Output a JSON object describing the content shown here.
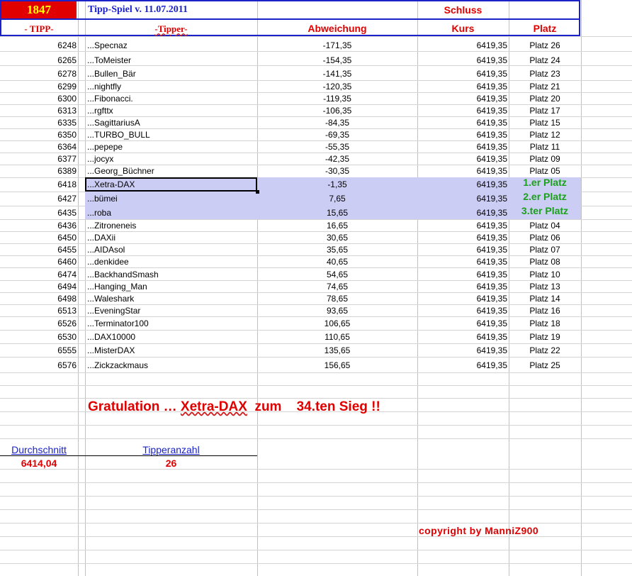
{
  "header": {
    "badge": "1847",
    "title": "Tipp-Spiel v. 11.07.2011",
    "schluss": "Schluss",
    "col_tipp": "- TIPP-",
    "col_tipper": "-Tipper-",
    "col_abweichung": "Abweichung",
    "col_kurs": "Kurs",
    "col_platz": "Platz"
  },
  "rows": [
    {
      "tipp": "6248",
      "name": "...Specnaz",
      "abw": "-171,35",
      "kurs": "6419,35",
      "platz": "Platz 26"
    },
    {
      "tipp": "6265",
      "name": "...ToMeister",
      "abw": "-154,35",
      "kurs": "6419,35",
      "platz": "Platz 24"
    },
    {
      "tipp": "6278",
      "name": "...Bullen_Bär",
      "abw": "-141,35",
      "kurs": "6419,35",
      "platz": "Platz 23"
    },
    {
      "tipp": "6299",
      "name": "...nightfly",
      "abw": "-120,35",
      "kurs": "6419,35",
      "platz": "Platz 21"
    },
    {
      "tipp": "6300",
      "name": "...Fibonacci.",
      "abw": "-119,35",
      "kurs": "6419,35",
      "platz": "Platz 20"
    },
    {
      "tipp": "6313",
      "name": "...rgfttx",
      "abw": "-106,35",
      "kurs": "6419,35",
      "platz": "Platz 17"
    },
    {
      "tipp": "6335",
      "name": "...SagittariusA",
      "abw": "-84,35",
      "kurs": "6419,35",
      "platz": "Platz 15"
    },
    {
      "tipp": "6350",
      "name": "...TURBO_BULL",
      "abw": "-69,35",
      "kurs": "6419,35",
      "platz": "Platz 12"
    },
    {
      "tipp": "6364",
      "name": "...pepepe",
      "abw": "-55,35",
      "kurs": "6419,35",
      "platz": "Platz 11"
    },
    {
      "tipp": "6377",
      "name": "...jocyx",
      "abw": "-42,35",
      "kurs": "6419,35",
      "platz": "Platz 09"
    },
    {
      "tipp": "6389",
      "name": "...Georg_Büchner",
      "abw": "-30,35",
      "kurs": "6419,35",
      "platz": "Platz 05"
    },
    {
      "tipp": "6418",
      "name": "...Xetra-DAX",
      "abw": "-1,35",
      "kurs": "6419,35",
      "platz": "1.er Platz"
    },
    {
      "tipp": "6427",
      "name": "...bümei",
      "abw": "7,65",
      "kurs": "6419,35",
      "platz": "2.er Platz"
    },
    {
      "tipp": "6435",
      "name": "...roba",
      "abw": "15,65",
      "kurs": "6419,35",
      "platz": "3.ter Platz"
    },
    {
      "tipp": "6436",
      "name": "...Zitroneneis",
      "abw": "16,65",
      "kurs": "6419,35",
      "platz": "Platz 04"
    },
    {
      "tipp": "6450",
      "name": "...DAXii",
      "abw": "30,65",
      "kurs": "6419,35",
      "platz": "Platz 06"
    },
    {
      "tipp": "6455",
      "name": "...AIDAsol",
      "abw": "35,65",
      "kurs": "6419,35",
      "platz": "Platz 07"
    },
    {
      "tipp": "6460",
      "name": "...denkidee",
      "abw": "40,65",
      "kurs": "6419,35",
      "platz": "Platz 08"
    },
    {
      "tipp": "6474",
      "name": "...BackhandSmash",
      "abw": "54,65",
      "kurs": "6419,35",
      "platz": "Platz 10"
    },
    {
      "tipp": "6494",
      "name": "...Hanging_Man",
      "abw": "74,65",
      "kurs": "6419,35",
      "platz": "Platz 13"
    },
    {
      "tipp": "6498",
      "name": "...Waleshark",
      "abw": "78,65",
      "kurs": "6419,35",
      "platz": "Platz 14"
    },
    {
      "tipp": "6513",
      "name": "...EveningStar",
      "abw": "93,65",
      "kurs": "6419,35",
      "platz": "Platz 16"
    },
    {
      "tipp": "6526",
      "name": "...Terminator100",
      "abw": "106,65",
      "kurs": "6419,35",
      "platz": "Platz 18"
    },
    {
      "tipp": "6530",
      "name": "...DAX10000",
      "abw": "110,65",
      "kurs": "6419,35",
      "platz": "Platz 19"
    },
    {
      "tipp": "6555",
      "name": "...MisterDAX",
      "abw": "135,65",
      "kurs": "6419,35",
      "platz": "Platz 22"
    },
    {
      "tipp": "6576",
      "name": "...Zickzackmaus",
      "abw": "156,65",
      "kurs": "6419,35",
      "platz": "Platz 25"
    }
  ],
  "congrats": {
    "prefix": "Gratulation  …",
    "winner": "Xetra-DAX",
    "suffix": "  zum    34.ten Sieg !!"
  },
  "summary": {
    "avg_label": "Durchschnitt",
    "avg_value": "6414,04",
    "count_label": "Tipperanzahl",
    "count_value": "26"
  },
  "copyright": "copyright by ManniZ900",
  "colors": {
    "accent_blue": "#1a22c8",
    "accent_red": "#e00000",
    "winner_green": "#1aa01a",
    "highlight": "#cccdf5",
    "badge_text": "#ffff00"
  }
}
